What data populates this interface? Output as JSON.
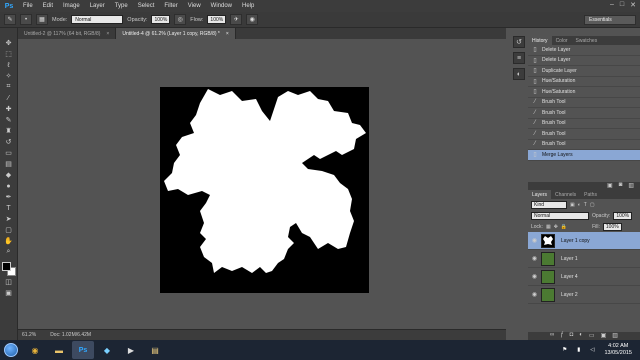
{
  "app": {
    "logo": "Ps",
    "menu": [
      "File",
      "Edit",
      "Image",
      "Layer",
      "Type",
      "Select",
      "Filter",
      "View",
      "Window",
      "Help"
    ],
    "window_controls": [
      "–",
      "□",
      "✕"
    ]
  },
  "options": {
    "mode_label": "Mode:",
    "mode_value": "Normal",
    "opacity_label": "Opacity:",
    "opacity_value": "100%",
    "flow_label": "Flow:",
    "flow_value": "100%",
    "workspace": "Essentials"
  },
  "tabs": [
    {
      "label": "Untitled-2 @ 117% (64 bit, RGB/8)",
      "close": "×"
    },
    {
      "label": "Untitled-4 @ 61.2% (Layer 1 copy, RGB/8) *",
      "close": "×"
    }
  ],
  "status": {
    "zoom": "61.2%",
    "doc": "Doc: 1.02M/6.42M"
  },
  "history": {
    "tabs": [
      "History",
      "Color",
      "Swatches"
    ],
    "items": [
      {
        "label": "Delete Layer",
        "icon": "document-icon"
      },
      {
        "label": "Delete Layer",
        "icon": "document-icon"
      },
      {
        "label": "Duplicate Layer",
        "icon": "document-icon"
      },
      {
        "label": "Hue/Saturation",
        "icon": "document-icon"
      },
      {
        "label": "Hue/Saturation",
        "icon": "document-icon"
      },
      {
        "label": "Brush Tool",
        "icon": "brush-icon"
      },
      {
        "label": "Brush Tool",
        "icon": "brush-icon"
      },
      {
        "label": "Brush Tool",
        "icon": "brush-icon"
      },
      {
        "label": "Brush Tool",
        "icon": "brush-icon"
      },
      {
        "label": "Brush Tool",
        "icon": "brush-icon"
      },
      {
        "label": "Merge Layers",
        "icon": "document-icon"
      }
    ]
  },
  "layers": {
    "tabs": [
      "Layers",
      "Channels",
      "Paths"
    ],
    "kind": "Kind",
    "blend": "Normal",
    "opacity_label": "Opacity:",
    "opacity_value": "100%",
    "lock_label": "Lock:",
    "fill_label": "Fill:",
    "fill_value": "100%",
    "items": [
      {
        "name": "Layer 1 copy",
        "thumb": "black"
      },
      {
        "name": "Layer 1",
        "thumb": "green"
      },
      {
        "name": "Layer 4",
        "thumb": "green"
      },
      {
        "name": "Layer 2",
        "thumb": "green"
      }
    ]
  },
  "taskbar": {
    "time": "4:02 AM",
    "date": "13/05/2015"
  },
  "colors": {
    "history_selected": "#8aa7d4",
    "canvas_bg": "#000000",
    "leaf": "#ffffff"
  }
}
